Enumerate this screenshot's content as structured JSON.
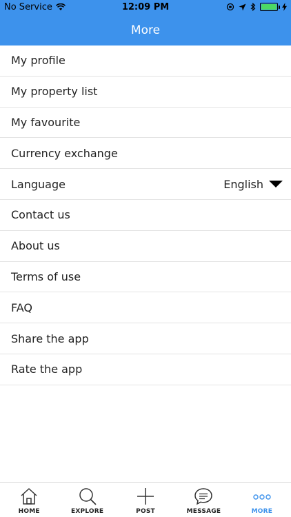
{
  "status_bar": {
    "carrier": "No Service",
    "time": "12:09 PM",
    "battery_level": 1.0
  },
  "nav": {
    "title": "More"
  },
  "menu": {
    "items": [
      {
        "label": "My profile"
      },
      {
        "label": "My property list"
      },
      {
        "label": "My favourite"
      },
      {
        "label": "Currency exchange"
      },
      {
        "label": "Language",
        "value": "English"
      },
      {
        "label": "Contact us"
      },
      {
        "label": "About us"
      },
      {
        "label": "Terms of use"
      },
      {
        "label": "FAQ"
      },
      {
        "label": "Share the app"
      },
      {
        "label": "Rate the app"
      }
    ]
  },
  "tab_bar": {
    "tabs": [
      {
        "label": "HOME",
        "icon": "home-icon"
      },
      {
        "label": "EXPLORE",
        "icon": "search-icon"
      },
      {
        "label": "POST",
        "icon": "plus-icon"
      },
      {
        "label": "MESSAGE",
        "icon": "chat-icon"
      },
      {
        "label": "MORE",
        "icon": "more-dots-icon",
        "active": true
      }
    ]
  },
  "colors": {
    "brand": "#3d92ec",
    "text": "#222222",
    "divider": "#e3e3e3"
  }
}
